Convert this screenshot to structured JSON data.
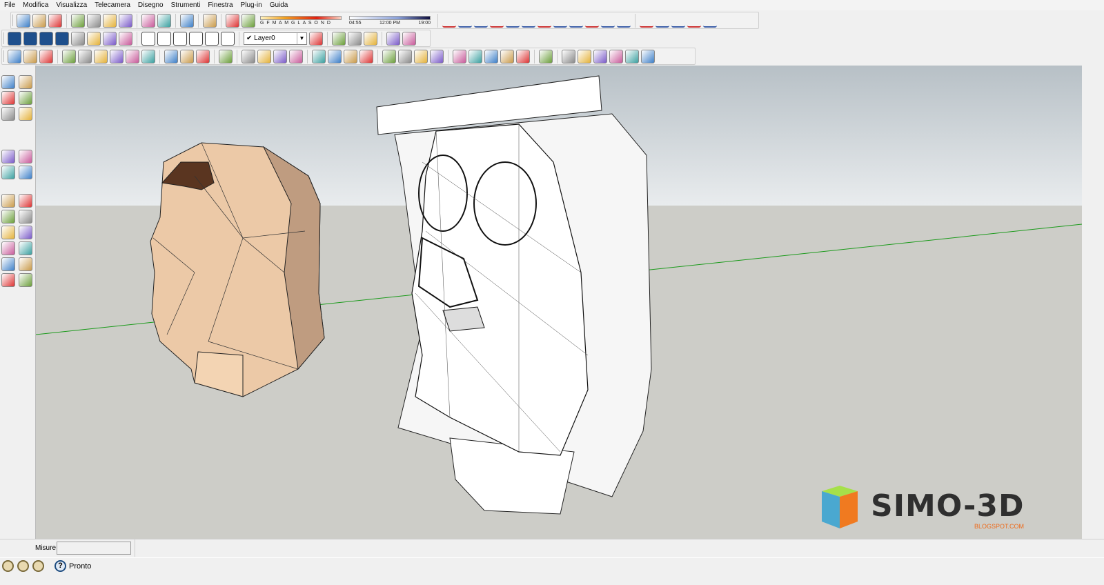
{
  "menu": [
    "File",
    "Modifica",
    "Visualizza",
    "Telecamera",
    "Disegno",
    "Strumenti",
    "Finestra",
    "Plug-in",
    "Guida"
  ],
  "toolbar1": {
    "icons_a": [
      "new-icon",
      "open-icon",
      "save-icon",
      "cut-icon",
      "copy-icon",
      "paste-icon",
      "erase-icon",
      "undo-icon",
      "redo-icon",
      "print-icon",
      "model-info-icon",
      "component-info-icon",
      "component-icon"
    ],
    "shadow_months": "G F M A M G L A S O N D",
    "time_start": "04:55",
    "time_mid": "12:00 PM",
    "time_end": "19:00",
    "icons_b": [
      "arc-tool-icon",
      "freehand-curve-icon",
      "bezier-icon",
      "spline-icon",
      "curve-icon",
      "rectangle-curve-icon",
      "spiral-icon",
      "arc2-icon",
      "polyline-icon",
      "curve2-icon",
      "arc3-icon",
      "arc4-icon",
      "line-curve-icon",
      "polygon-icon",
      "wrench-icon",
      "blob-icon",
      "cone-curve-icon"
    ]
  },
  "toolbar2": {
    "icons_a": [
      "scene-1-icon",
      "scene-2-icon",
      "film-icon",
      "scene-person-icon",
      "ufo-icon",
      "cone-icon",
      "color-grid-icon",
      "dots-grid-icon"
    ],
    "icons_b": [
      "iso-view-icon",
      "front-view-icon",
      "top-view-icon",
      "right-view-icon",
      "back-view-icon",
      "left-view-icon"
    ],
    "layer": "Layer0",
    "icons_c": [
      "layer-manager-icon",
      "push-j-icon",
      "push-v-icon",
      "push-n-icon",
      "rotate-push-icon",
      "push-pull-2-icon"
    ]
  },
  "toolbar3": {
    "icons": [
      "sandbox-icon",
      "follow-me-icon",
      "shell-icon",
      "xray-icon",
      "wireframe-icon",
      "hidden-line-icon",
      "shaded-icon",
      "textured-icon",
      "monochrome-icon",
      "solid-union-icon",
      "solid-intersect-icon",
      "solid-trim-icon",
      "select-icon",
      "pencil-icon",
      "rectangle-icon",
      "circle-icon",
      "arc-icon",
      "make-component-icon",
      "eraser-icon",
      "tape-measure-icon",
      "paint-bucket-icon",
      "push-pull-icon",
      "move-icon",
      "rotate-icon",
      "offset-icon",
      "orbit-icon",
      "pan-icon",
      "zoom-icon",
      "zoom-extents-icon",
      "previous-view-icon",
      "next-view-icon",
      "place-model-icon",
      "get-models-icon",
      "share-icon",
      "warehouse-icon",
      "extension-icon",
      "export-icon"
    ]
  },
  "colors": {
    "green_axis": "#1a9a1a",
    "logo_text": "#2f2f2f",
    "logo_sub": "#ee6a1a"
  },
  "logo": {
    "text": "SIMO-3D",
    "sub": "BLOGSPOT.COM"
  },
  "status": {
    "measure_label": "Misure",
    "measure_value": "",
    "message": "Pronto"
  }
}
